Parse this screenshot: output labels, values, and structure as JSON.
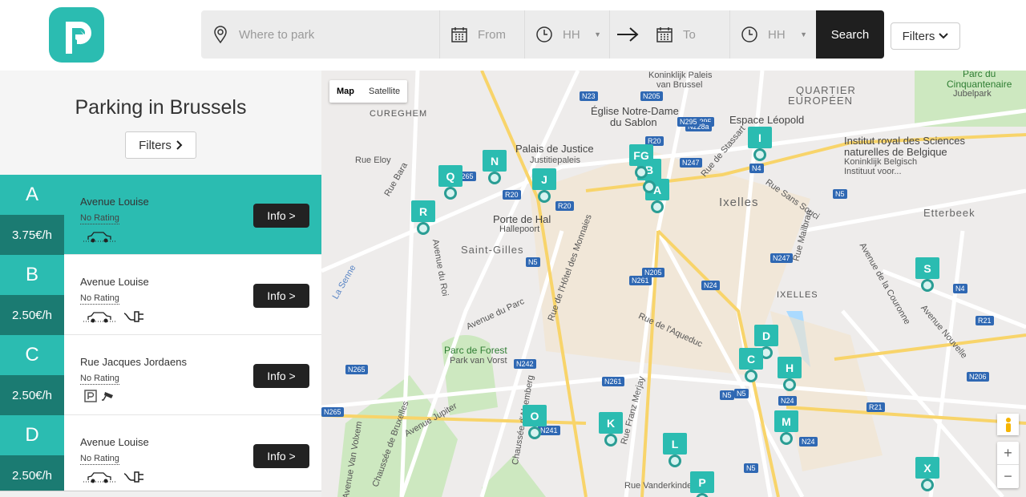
{
  "header": {
    "logo_letter": "P",
    "search": {
      "where_placeholder": "Where to park",
      "from_placeholder": "From",
      "from_hour": "HH",
      "to_placeholder": "To",
      "to_hour": "HH",
      "search_label": "Search"
    },
    "filters_label": "Filters"
  },
  "sidebar": {
    "title": "Parking in Brussels",
    "filters_label": "Filters",
    "items": [
      {
        "letter": "A",
        "price": "3.75€/h",
        "street": "Avenue Louise",
        "rating": "No Rating",
        "info": "Info >"
      },
      {
        "letter": "B",
        "price": "2.50€/h",
        "street": "Avenue Louise",
        "rating": "No Rating",
        "info": "Info >"
      },
      {
        "letter": "C",
        "price": "2.50€/h",
        "street": "Rue Jacques Jordaens",
        "rating": "No Rating",
        "info": "Info >"
      },
      {
        "letter": "D",
        "price": "2.50€/h",
        "street": "Avenue Louise",
        "rating": "No Rating",
        "info": "Info >"
      }
    ]
  },
  "map": {
    "type_map": "Map",
    "type_satellite": "Satellite",
    "labels": {
      "cureghem": "CUREGHEM",
      "palais": "Palais de Justice",
      "justitie": "Justitiepaleis",
      "sablon1": "Église Notre-Dame",
      "sablon2": "du Sablon",
      "koninklijk1": "Koninklijk Paleis",
      "koninklijk2": "van Brussel",
      "quartier1": "QUARTIER",
      "quartier2": "EUROPÉEN",
      "parc1": "Parc du",
      "parc2": "Cinquantenaire",
      "jubel": "Jubelpark",
      "leopold": "Espace Léopold",
      "institut1": "Institut royal des Sciences",
      "institut2": "naturelles de Belgique",
      "institut3": "Koninklijk Belgisch",
      "institut4": "Instituut voor...",
      "porte": "Porte de Hal",
      "hallepoort": "Hallepoort",
      "stgilles": "Saint-Gilles",
      "ixelles": "Ixelles",
      "ixelles2": "IXELLES",
      "etterbeek": "Etterbeek",
      "forest1": "Parc de Forest",
      "forest2": "Park van Vorst",
      "senne": "La Senne",
      "eloy": "Rue Eloy",
      "roi": "Avenue du Roi",
      "parcav": "Avenue du Parc",
      "aqueduc": "Rue de l'Aqueduc",
      "couronne": "Avenue de la Couronne",
      "mailbran": "Rue Mailbran",
      "vanderk": "Rue Vanderkindere",
      "alsemberg": "Chaussée d'Alsemberg",
      "jupiter": "Avenue Jupiter",
      "stassart": "Rue de Stassart",
      "souci": "Rue Sans Souci",
      "monnaies": "Rue de l'Hôtel des Monnaies",
      "bara": "Rue Bara",
      "merjay": "Rue Franz Merjay",
      "nouvelle": "Avenue Nouvelle",
      "vanvolxem": "Avenue Van Volxem",
      "bruxelles": "Chaussée de Bruxelles"
    },
    "roads": [
      "N23",
      "N205",
      "N295",
      "N228a",
      "N295",
      "R20",
      "N247",
      "N4",
      "N5",
      "R20",
      "R20",
      "N265",
      "N5",
      "N247",
      "N261",
      "N24",
      "N205",
      "N4",
      "R21",
      "N5",
      "N265",
      "N242",
      "N261",
      "N5",
      "N24",
      "N206",
      "R21",
      "N265",
      "N241",
      "N24",
      "N5"
    ],
    "markers": [
      "A",
      "B",
      "FG",
      "I",
      "N",
      "Q",
      "J",
      "R",
      "S",
      "D",
      "C",
      "H",
      "M",
      "O",
      "K",
      "L",
      "P",
      "X"
    ],
    "zoom_in": "+",
    "zoom_out": "−"
  }
}
